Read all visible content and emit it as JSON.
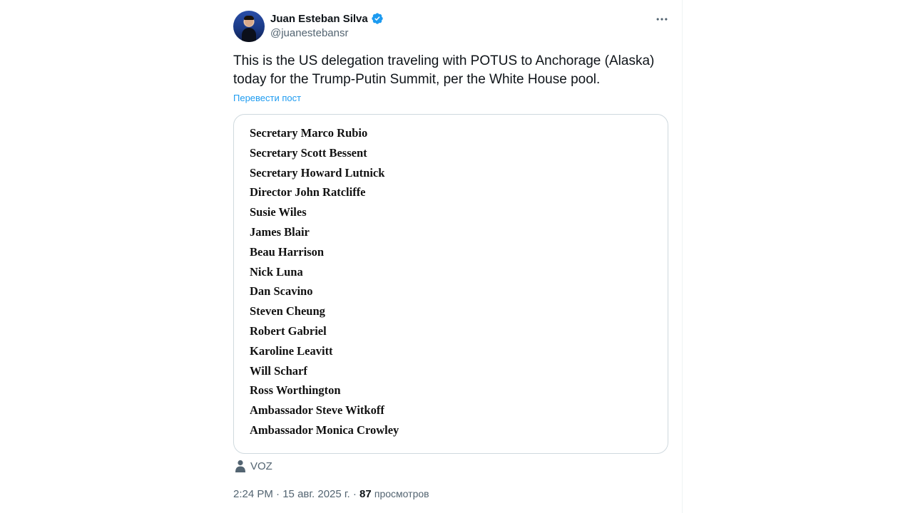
{
  "author": {
    "display_name": "Juan Esteban Silva",
    "handle": "@juanestebansr",
    "verified": true
  },
  "tweet": {
    "text": "This is the US delegation traveling with POTUS to Anchorage (Alaska) today for the Trump-Putin Summit, per the White House pool.",
    "translate_label": "Перевести пост",
    "image_names": [
      "Secretary Marco Rubio",
      "Secretary Scott Bessent",
      "Secretary Howard Lutnick",
      "Director John Ratcliffe",
      "Susie Wiles",
      "James Blair",
      "Beau Harrison",
      "Nick Luna",
      "Dan Scavino",
      "Steven Cheung",
      "Robert Gabriel",
      "Karoline Leavitt",
      "Will Scharf",
      "Ross Worthington",
      "Ambassador Steve Witkoff",
      "Ambassador Monica Crowley"
    ],
    "source_label": "VOZ",
    "time": "2:24 PM",
    "separator": "·",
    "date": "15 авг. 2025 г.",
    "views_count": "87",
    "views_label": "просмотров"
  },
  "icons": {
    "verified": "verified-badge-icon",
    "more": "more-horizontal-icon",
    "source": "person-icon"
  },
  "colors": {
    "accent": "#1d9bf0",
    "secondary_text": "#536471",
    "primary_text": "#0f1419",
    "border": "#cfd9de"
  }
}
